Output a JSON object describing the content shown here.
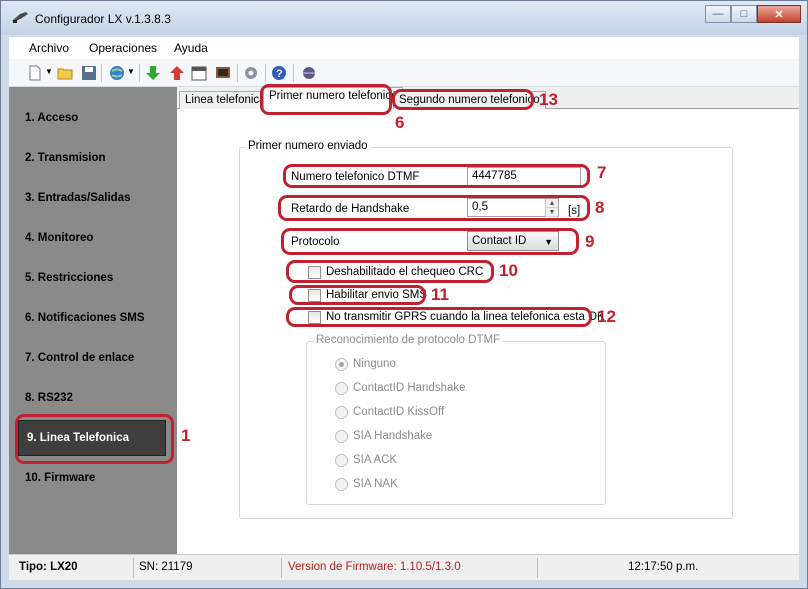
{
  "window": {
    "title": "Configurador LX v.1.3.8.3"
  },
  "menu": {
    "items": [
      "Archivo",
      "Operaciones",
      "Ayuda"
    ]
  },
  "toolbar": {
    "icons": [
      "new-icon",
      "open-folder-icon",
      "save-icon",
      "globe-icon",
      "download-arrow-icon",
      "upload-arrow-icon",
      "calendar-icon",
      "monitor-icon",
      "gear-icon",
      "help-icon",
      "globe-small-icon"
    ]
  },
  "sidebar": {
    "items": [
      {
        "label": "1. Acceso"
      },
      {
        "label": "2. Transmision"
      },
      {
        "label": "3. Entradas/Salidas"
      },
      {
        "label": "4. Monitoreo"
      },
      {
        "label": "5. Restricciones"
      },
      {
        "label": "6. Notificaciones SMS"
      },
      {
        "label": "7. Control de enlace"
      },
      {
        "label": "8. RS232"
      },
      {
        "label": "9. Linea Telefonica"
      },
      {
        "label": "10. Firmware"
      }
    ],
    "selected": "9. Linea Telefonica"
  },
  "tabs": [
    {
      "label": "Linea telefonica"
    },
    {
      "label": "Primer numero telefonico"
    },
    {
      "label": "Segundo numero telefonico"
    }
  ],
  "form": {
    "group_title": "Primer numero enviado",
    "dtmf_label": "Numero telefonico DTMF",
    "dtmf_value": "4447785",
    "handshake_label": "Retardo de Handshake",
    "handshake_value": "0,5",
    "handshake_unit": "[s]",
    "protocol_label": "Protocolo",
    "protocol_value": "Contact ID",
    "crc_label": "Deshabilitado el chequeo CRC",
    "sms_label": "Habilitar envio SMS",
    "gprs_label": "No transmitir GPRS cuando la linea telefonica esta OK",
    "dtmf_group_title": "Reconocimiento de protocolo DTMF",
    "radio_options": [
      "Ninguno",
      "ContactID Handshake",
      "ContactID KissOff",
      "SIA Handshake",
      "SIA ACK",
      "SIA NAK"
    ],
    "radio_selected": "Ninguno"
  },
  "annotations": [
    "1",
    "6",
    "7",
    "8",
    "9",
    "10",
    "11",
    "12",
    "13"
  ],
  "status": {
    "tipo": "Tipo: LX20",
    "sn": "SN: 21179",
    "firmware": "Version de Firmware: 1.10.5/1.3.0",
    "time": "12:17:50 p.m."
  },
  "colors": {
    "annotation": "#c0202f",
    "sidebar_bg": "#8a8a8a",
    "sidebar_active": "#3e3e3e",
    "firmware_text": "#b22222"
  }
}
